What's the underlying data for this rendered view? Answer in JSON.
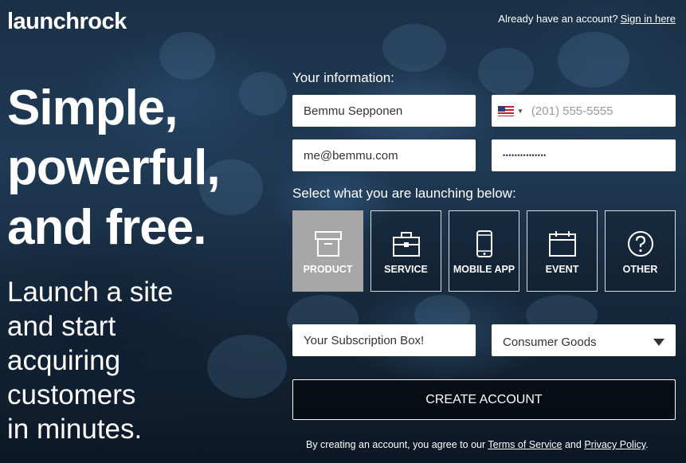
{
  "header": {
    "logo_text": "launchrock",
    "signin_prompt": "Already have an account?",
    "signin_link": "Sign in here"
  },
  "hero": {
    "headline_lines": [
      "Simple,",
      "powerful,",
      "and free."
    ],
    "subline_lines": [
      "Launch a site",
      "and start",
      "acquiring",
      "customers",
      "in minutes."
    ]
  },
  "form": {
    "info_label": "Your information:",
    "name_value": "Bemmu Sepponen",
    "phone_placeholder": "(201) 555-5555",
    "email_value": "me@bemmu.com",
    "password_mask": "•••••••••••••••",
    "launch_label": "Select what you are launching below:",
    "types": [
      {
        "label": "PRODUCT",
        "icon": "box-icon",
        "selected": true
      },
      {
        "label": "SERVICE",
        "icon": "briefcase-icon",
        "selected": false
      },
      {
        "label": "MOBILE APP",
        "icon": "phone-icon",
        "selected": false
      },
      {
        "label": "EVENT",
        "icon": "calendar-icon",
        "selected": false
      },
      {
        "label": "OTHER",
        "icon": "question-icon",
        "selected": false
      }
    ],
    "product_name_value": "Your Subscription Box!",
    "category_selected": "Consumer Goods",
    "submit_label": "CREATE ACCOUNT",
    "terms_prefix": "By creating an account, you agree to our",
    "terms_link": "Terms of Service",
    "terms_and": "and",
    "privacy_link": "Privacy Policy",
    "terms_end": "."
  },
  "colors": {
    "selected_tile": "#a7a7a7",
    "field_bg": "#ffffff",
    "page_bg": "#1a3047"
  }
}
